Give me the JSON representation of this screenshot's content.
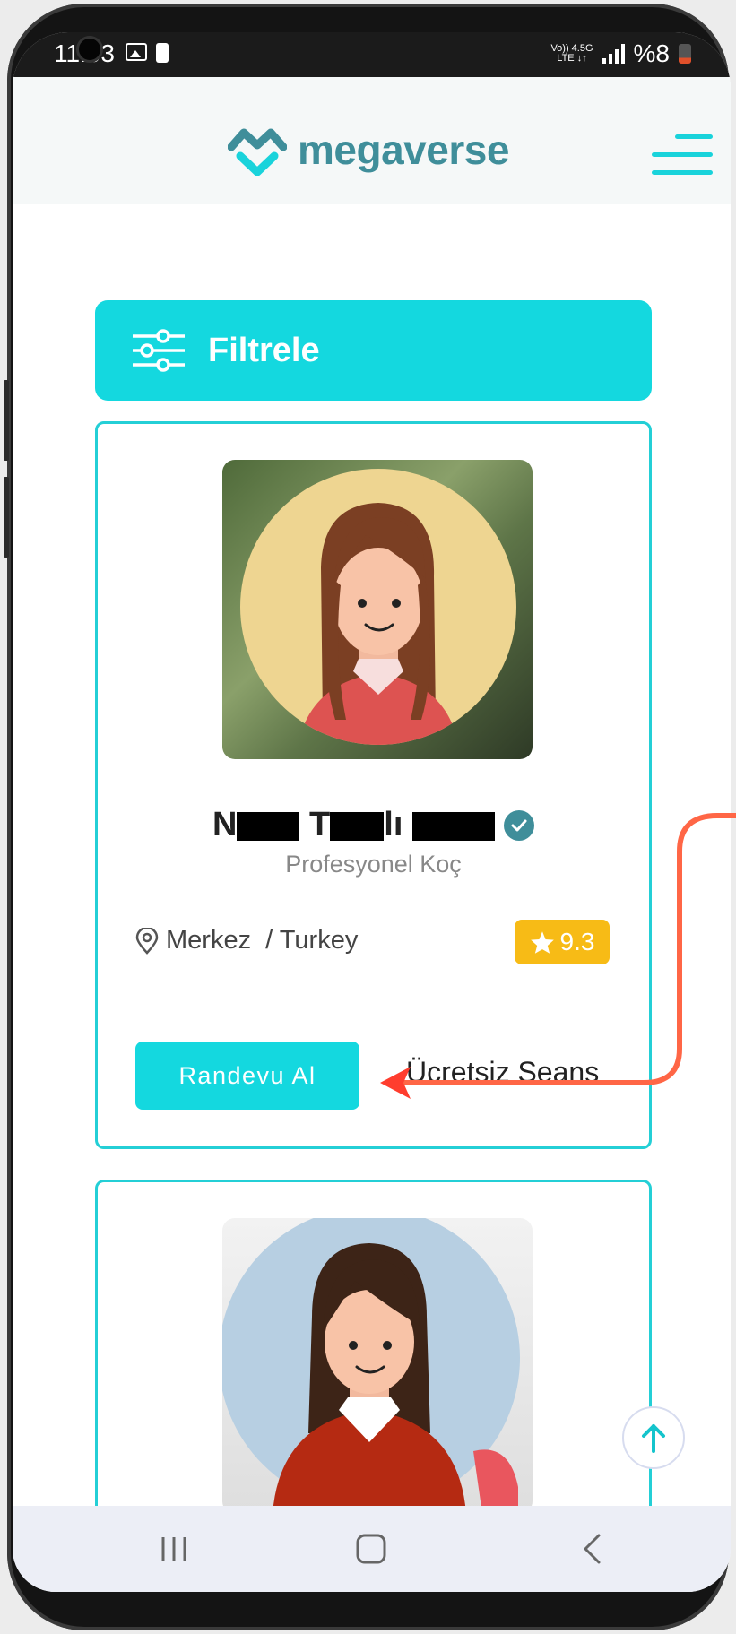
{
  "status_bar": {
    "time": "11:03",
    "network_top": "Vo)) 4.5G",
    "network_bottom": "LTE ↓↑",
    "battery": "%8"
  },
  "header": {
    "logo_text": "megaverse",
    "menu_icon": "hamburger-icon",
    "accent_color": "#19d3db"
  },
  "filter": {
    "label": "Filtrele",
    "icon": "sliders-icon"
  },
  "coaches": [
    {
      "name_visible_start": "N",
      "name_visible_mid": "T",
      "name_visible_end": "lı",
      "verified": true,
      "title": "Profesyonel Koç",
      "location": "Merkez  / Turkey",
      "rating": "9.3",
      "book_label": "Randevu Al",
      "free_session_label": "Ücretsiz Seans"
    },
    {
      "name_visible_start": "",
      "title": ""
    }
  ],
  "scroll_top_icon": "arrow-up-icon",
  "nav_bar": {
    "recents_icon": "recents-icon",
    "home_icon": "home-icon",
    "back_icon": "back-icon"
  },
  "annotation": {
    "arrow_color": "#ff6646"
  }
}
